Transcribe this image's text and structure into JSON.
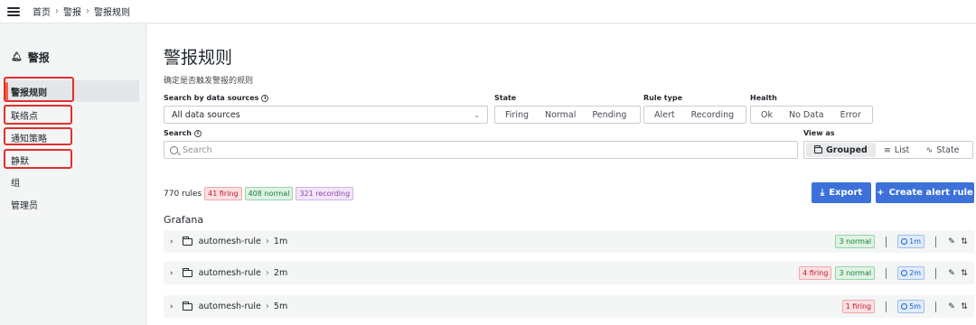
{
  "breadcrumb": [
    "首页",
    "警报",
    "警报规则"
  ],
  "sidebar": {
    "title": "警报",
    "items": [
      {
        "label": "警报规则",
        "active": true
      },
      {
        "label": "联络点",
        "active": false
      },
      {
        "label": "通知策略",
        "active": false
      },
      {
        "label": "静默",
        "active": false
      },
      {
        "label": "组",
        "active": false
      },
      {
        "label": "管理员",
        "active": false
      }
    ]
  },
  "page": {
    "title": "警报规则",
    "subtitle": "确定是否触发警报的规则"
  },
  "filters": {
    "datasource_label": "Search by data sources",
    "datasource_value": "All data sources",
    "state_label": "State",
    "state_options": [
      "Firing",
      "Normal",
      "Pending"
    ],
    "ruletype_label": "Rule type",
    "ruletype_options": [
      "Alert",
      "Recording"
    ],
    "health_label": "Health",
    "health_options": [
      "Ok",
      "No Data",
      "Error"
    ],
    "search_label": "Search",
    "search_placeholder": "Search",
    "viewas_label": "View as",
    "viewas_options": [
      "Grouped",
      "List",
      "State"
    ],
    "viewas_selected": "Grouped"
  },
  "summary": {
    "total": "770 rules",
    "firing": "41 firing",
    "normal": "408 normal",
    "recording": "321 recording"
  },
  "actions": {
    "export": "Export",
    "create": "Create alert rule"
  },
  "group_heading": "Grafana",
  "rule_groups": [
    {
      "name": "automesh-rule",
      "interval": "1m",
      "firing": "",
      "normal": "3 normal"
    },
    {
      "name": "automesh-rule",
      "interval": "2m",
      "firing": "4 firing",
      "normal": "3 normal"
    },
    {
      "name": "automesh-rule",
      "interval": "5m",
      "firing": "1 firing",
      "normal": ""
    }
  ],
  "colors": {
    "accent": "#f55f3e",
    "primary_button": "#3d71d9",
    "highlight_box": "#e02f2f"
  }
}
